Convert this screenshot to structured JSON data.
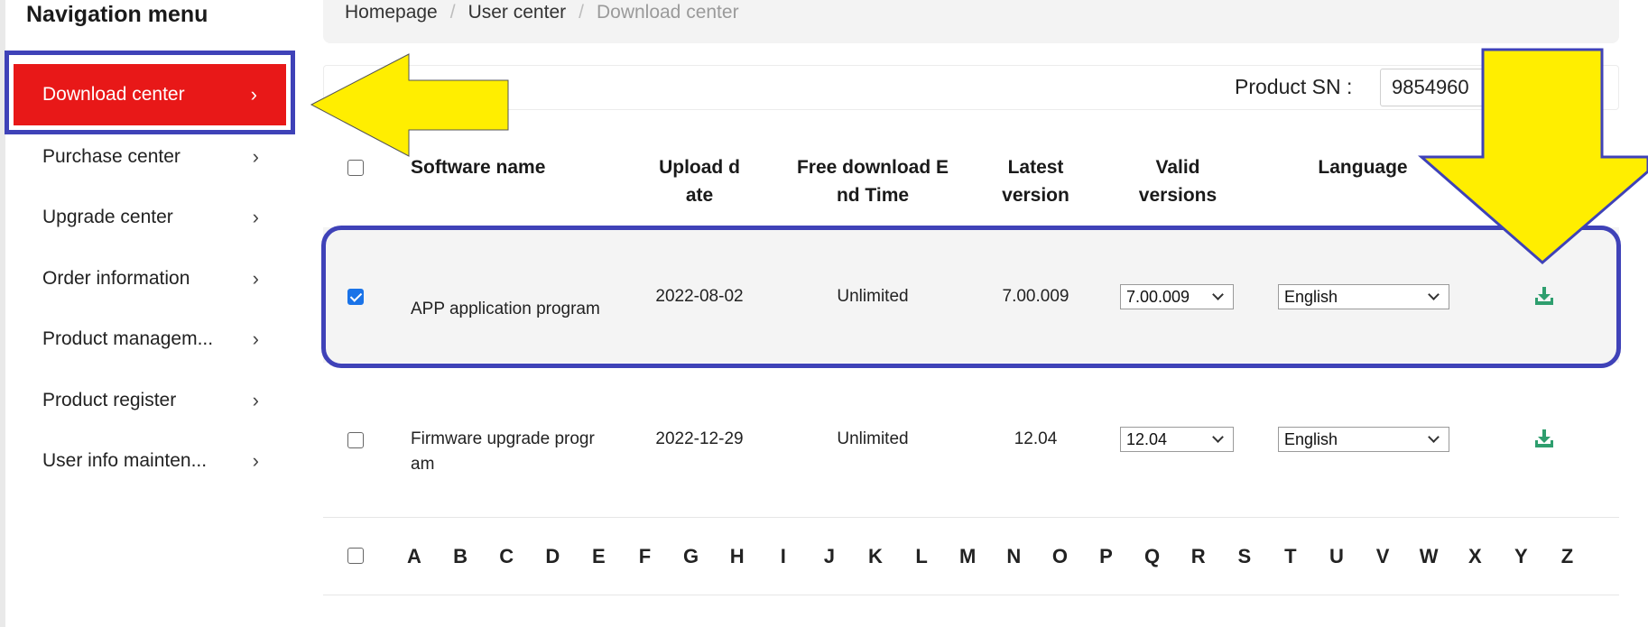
{
  "sidebar": {
    "title": "Navigation menu",
    "chevron": "›",
    "items": [
      {
        "label": "Download center",
        "active": true
      },
      {
        "label": "Purchase center"
      },
      {
        "label": "Upgrade center"
      },
      {
        "label": "Order information"
      },
      {
        "label": "Product managem..."
      },
      {
        "label": "Product register"
      },
      {
        "label": "User info mainten..."
      }
    ]
  },
  "breadcrumb": {
    "items": [
      "Homepage",
      "User center",
      "Download center"
    ],
    "separator": "/"
  },
  "sn": {
    "label": "Product SN :",
    "value": "9854960"
  },
  "table": {
    "headers": {
      "name": "Software name",
      "upload_line1": "Upload d",
      "upload_line2": "ate",
      "free_line1": "Free download E",
      "free_line2": "nd Time",
      "latest_line1": "Latest",
      "latest_line2": "version",
      "valid_line1": "Valid",
      "valid_line2": "versions",
      "language": "Language"
    },
    "rows": [
      {
        "checked": true,
        "name": "APP application program",
        "upload_date": "2022-08-02",
        "free_end": "Unlimited",
        "latest": "7.00.009",
        "valid_selected": "7.00.009",
        "language_selected": "English",
        "download_icon": "download-icon"
      },
      {
        "checked": false,
        "name_line1": "Firmware upgrade progr",
        "name_line2": "am",
        "upload_date": "2022-12-29",
        "free_end": "Unlimited",
        "latest": "12.04",
        "valid_selected": "12.04",
        "language_selected": "English",
        "download_icon": "download-icon"
      }
    ]
  },
  "alphabet": [
    "A",
    "B",
    "C",
    "D",
    "E",
    "F",
    "G",
    "H",
    "I",
    "J",
    "K",
    "L",
    "M",
    "N",
    "O",
    "P",
    "Q",
    "R",
    "S",
    "T",
    "U",
    "V",
    "W",
    "X",
    "Y",
    "Z"
  ],
  "colors": {
    "active_nav": "#e81818",
    "highlight_border": "#3f42b8",
    "arrow_fill": "#ffee00",
    "download_icon": "#2e9e6e",
    "checkbox_checked": "#1a73e8"
  }
}
